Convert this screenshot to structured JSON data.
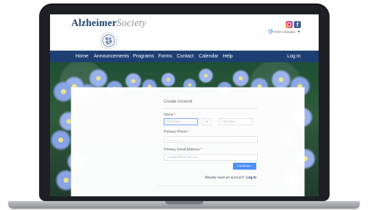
{
  "site": {
    "brand_main": "Alzheimer",
    "brand_accent": "Society"
  },
  "header": {
    "translate_label": "Select Language"
  },
  "nav": {
    "items": [
      {
        "label": "Home"
      },
      {
        "label": "Announcements"
      },
      {
        "label": "Programs"
      },
      {
        "label": "Forms"
      },
      {
        "label": "Contact"
      },
      {
        "label": "Calendar"
      },
      {
        "label": "Help"
      }
    ],
    "login_label": "Log In"
  },
  "form": {
    "title": "Create Account",
    "name_label": "Name",
    "first_name_placeholder": "First Name",
    "middle_initial": "MI",
    "last_name_placeholder": "Last Name",
    "phone_label": "Primary Phone",
    "phone_placeholder": "(___) ___-____",
    "email_label": "Primary Email Address",
    "email_placeholder": "example@example.com",
    "required_mark": "*",
    "continue_label": "Continue",
    "continue_arrow": "›",
    "account_prompt": "Already have an account?",
    "account_link": "Log In"
  },
  "icons": {
    "instagram": "instagram-icon",
    "facebook": "facebook-icon",
    "google": "google-icon",
    "dropdown": "chevron-down-icon",
    "logo": "flower-logo-icon"
  },
  "colors": {
    "brand_navy": "#16406e",
    "nav_background": "#1e3f73",
    "primary_button": "#4d8ff6",
    "required": "#d94848"
  }
}
